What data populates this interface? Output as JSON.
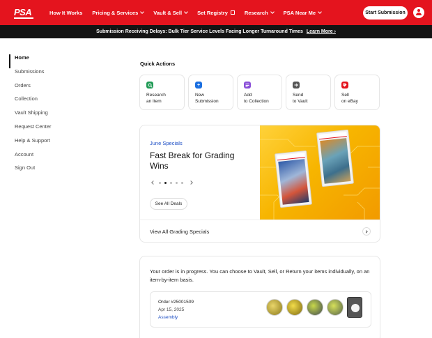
{
  "header": {
    "logo_text": "PSA",
    "nav": [
      {
        "label": "How It Works",
        "has_chevron": false
      },
      {
        "label": "Pricing & Services",
        "has_chevron": true
      },
      {
        "label": "Vault & Sell",
        "has_chevron": true
      },
      {
        "label": "Set Registry",
        "external": true
      },
      {
        "label": "Research",
        "has_chevron": true
      },
      {
        "label": "PSA Near Me",
        "has_chevron": true
      }
    ],
    "cta_label": "Start Submission",
    "accent_color": "#e4141e"
  },
  "banner": {
    "message": "Submission Receiving Delays: Bulk Tier Service Levels Facing Longer Turnaround Times",
    "link_label": "Learn More"
  },
  "sidebar": {
    "items": [
      {
        "label": "Home",
        "active": true
      },
      {
        "label": "Submissions"
      },
      {
        "label": "Orders"
      },
      {
        "label": "Collection"
      },
      {
        "label": "Vault Shipping"
      },
      {
        "label": "Request Center"
      },
      {
        "label": "Help & Support"
      },
      {
        "label": "Account"
      },
      {
        "label": "Sign Out"
      }
    ]
  },
  "quick_actions": {
    "title": "Quick Actions",
    "items": [
      {
        "line1": "Research",
        "line2": "an Item",
        "icon": "search-icon",
        "color": "#1f9a55"
      },
      {
        "line1": "New",
        "line2": "Submission",
        "icon": "plus-icon",
        "color": "#1b6fe0"
      },
      {
        "line1": "Add",
        "line2": "to Collection",
        "icon": "collection-icon",
        "color": "#8a4fd8"
      },
      {
        "line1": "Send",
        "line2": "to Vault",
        "icon": "send-arrow-icon",
        "color": "#555555"
      },
      {
        "line1": "Sell",
        "line2": "on eBay",
        "icon": "tag-icon",
        "color": "#e4141e"
      }
    ]
  },
  "specials": {
    "kicker": "June Specials",
    "title": "Fast Break for Grading Wins",
    "slide_count": 5,
    "active_slide": 1,
    "see_all_label": "See All Deals",
    "footer_label": "View All Grading Specials"
  },
  "order": {
    "message": "Your order is in progress. You can choose to Vault, Sell, or Return your items individually, on an item-by-item basis.",
    "id_label": "Order #25001509",
    "date": "Apr 15, 2025",
    "status": "Assembly",
    "thumbnails": [
      {
        "kind": "coin",
        "color": "#c9b23a"
      },
      {
        "kind": "coin",
        "color": "#d2b21c"
      },
      {
        "kind": "coin",
        "color": "#6f7f8a"
      },
      {
        "kind": "coin",
        "color": "#8a9a6a"
      },
      {
        "kind": "slab"
      }
    ]
  }
}
